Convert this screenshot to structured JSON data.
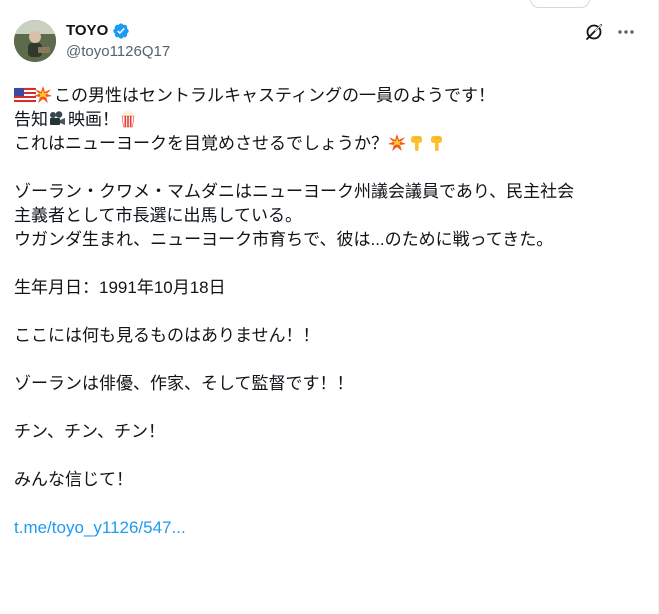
{
  "author": {
    "display_name": "TOYO",
    "handle": "@toyo1126Q17"
  },
  "icons": {
    "verified": "verified-badge-icon",
    "grok": "grok-icon",
    "more": "more-options-icon",
    "flag": "us-flag-emoji",
    "collision": "collision-emoji",
    "camera": "movie-camera-emoji",
    "popcorn": "popcorn-emoji",
    "point_down": "backhand-index-pointing-down-emoji"
  },
  "colors": {
    "link": "#1d9bf0",
    "verified": "#1d9bf0",
    "secondary_text": "#536471"
  },
  "tweet": {
    "line1": "この男性はセントラルキャスティングの一員のようです！",
    "line2a": "告知",
    "line2b": "映画！",
    "line3": "これはニューヨークを目覚めさせるでしょうか？",
    "line4": "ゾーラン・クワメ・マムダニはニューヨーク州議会議員であり、民主社会",
    "line5": "主義者として市長選に出馬している。",
    "line6": "ウガンダ生まれ、ニューヨーク市育ちで、彼は...のために戦ってきた。",
    "line7": "生年月日：1991年10月18日",
    "line8": "ここには何も見るものはありません！！",
    "line9": "ゾーランは俳優、作家、そして監督です！！",
    "line10": "チン、チン、チン！",
    "line11": "みんな信じて！",
    "link": "t.me/toyo_y1126/547..."
  }
}
